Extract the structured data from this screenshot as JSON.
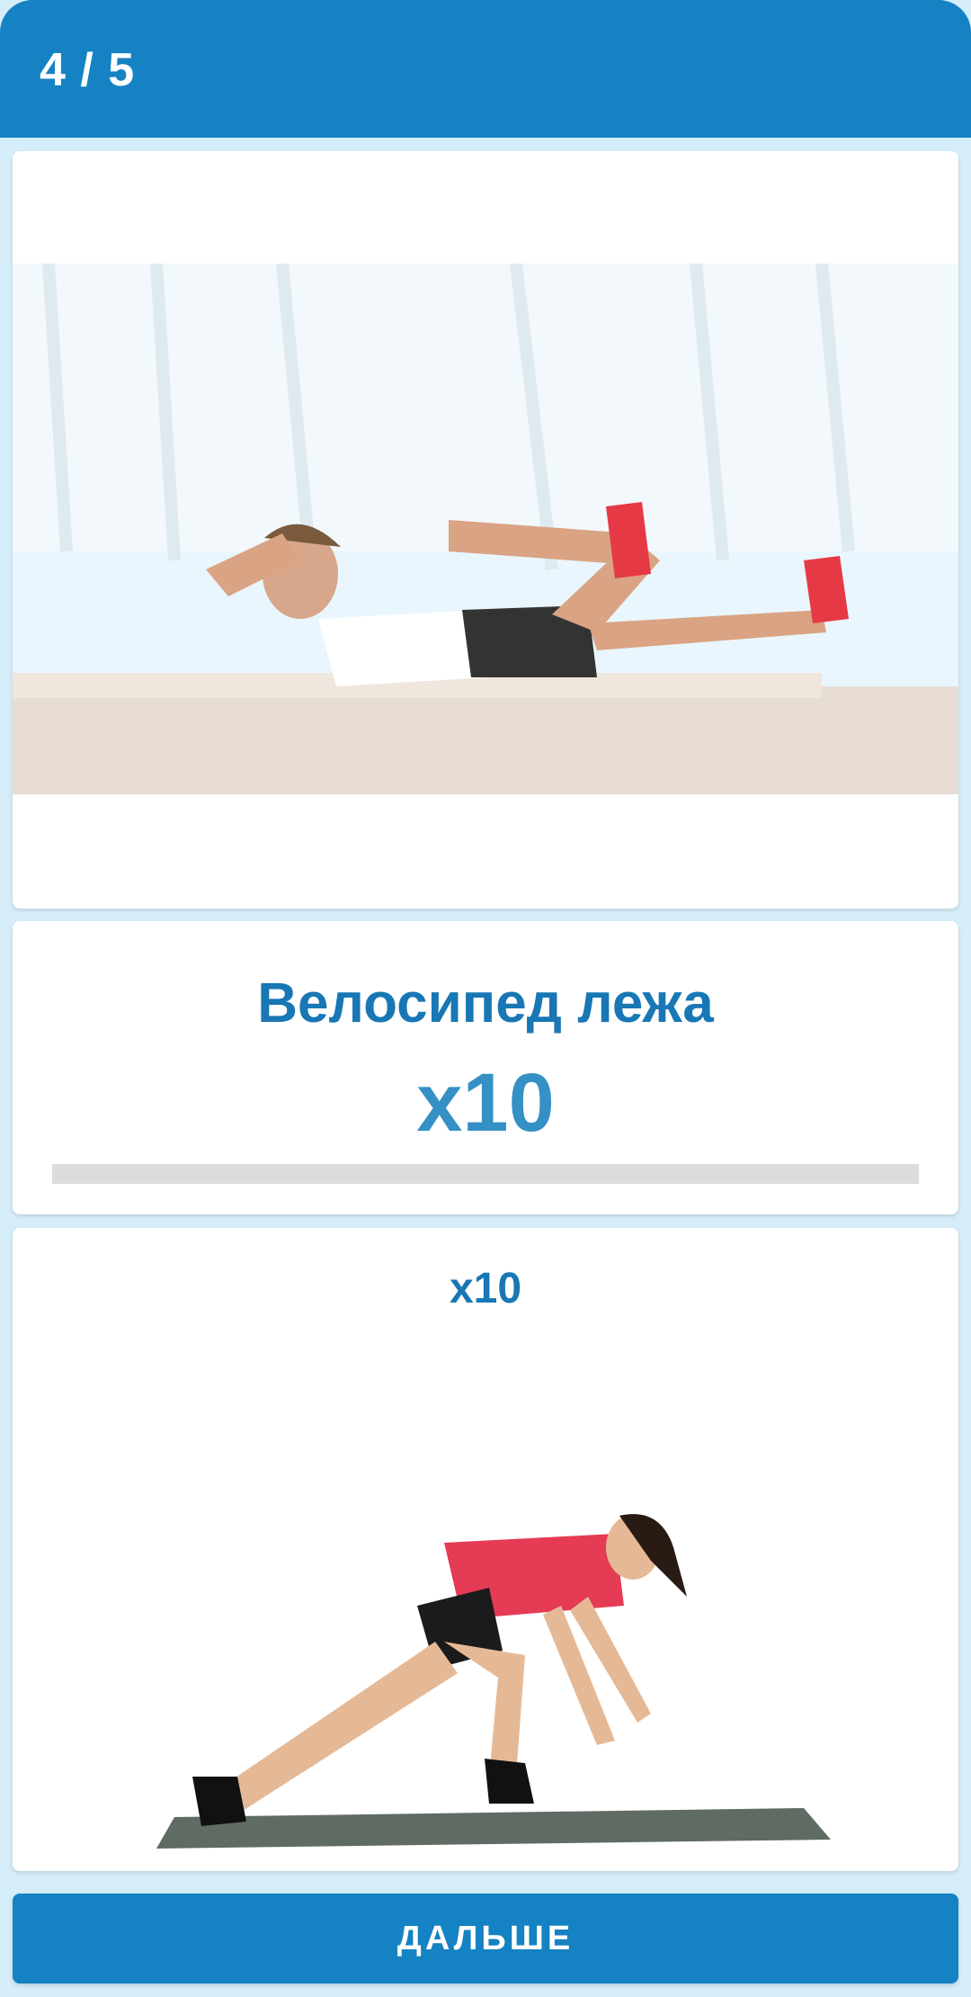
{
  "header": {
    "progress": "4 / 5"
  },
  "exercise": {
    "name": "Велосипед лежа",
    "reps": "x10",
    "progress_fraction": 0
  },
  "next": {
    "reps": "x10"
  },
  "footer": {
    "next_button": "ДАЛЬШЕ"
  },
  "colors": {
    "primary": "#1482c3",
    "background": "#d5edf8",
    "title": "#1877b4"
  }
}
